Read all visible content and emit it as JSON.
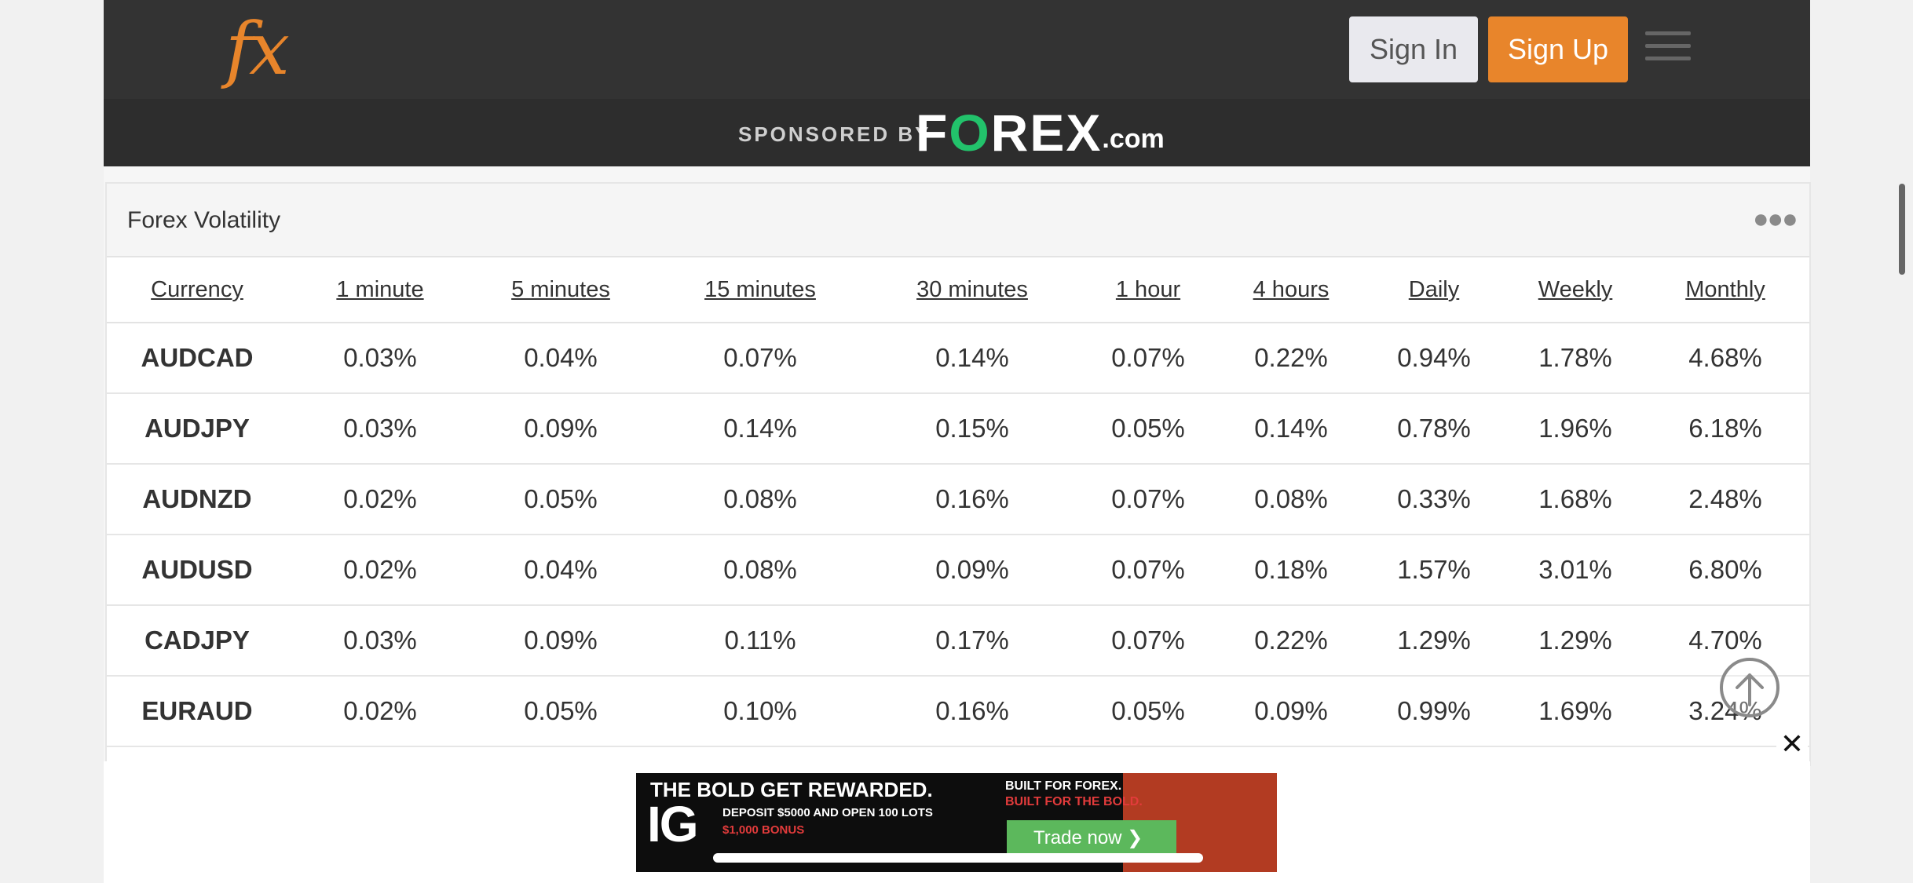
{
  "header": {
    "logo_text": "fx",
    "sign_in": "Sign In",
    "sign_up": "Sign Up",
    "menu_icon": "hamburger-icon"
  },
  "sponsor": {
    "label": "SPONSORED BY",
    "brand_f": "F",
    "brand_o": "O",
    "brand_rest": "REX",
    "brand_suffix": ".com"
  },
  "widget": {
    "title": "Forex Volatility",
    "more_icon": "more-dots-icon",
    "columns": [
      "Currency",
      "1 minute",
      "5 minutes",
      "15 minutes",
      "30 minutes",
      "1 hour",
      "4 hours",
      "Daily",
      "Weekly",
      "Monthly"
    ],
    "rows": [
      [
        "AUDCAD",
        "0.03%",
        "0.04%",
        "0.07%",
        "0.14%",
        "0.07%",
        "0.22%",
        "0.94%",
        "1.78%",
        "4.68%"
      ],
      [
        "AUDJPY",
        "0.03%",
        "0.09%",
        "0.14%",
        "0.15%",
        "0.05%",
        "0.14%",
        "0.78%",
        "1.96%",
        "6.18%"
      ],
      [
        "AUDNZD",
        "0.02%",
        "0.05%",
        "0.08%",
        "0.16%",
        "0.07%",
        "0.08%",
        "0.33%",
        "1.68%",
        "2.48%"
      ],
      [
        "AUDUSD",
        "0.02%",
        "0.04%",
        "0.08%",
        "0.09%",
        "0.07%",
        "0.18%",
        "1.57%",
        "3.01%",
        "6.80%"
      ],
      [
        "CADJPY",
        "0.03%",
        "0.09%",
        "0.11%",
        "0.17%",
        "0.07%",
        "0.22%",
        "1.29%",
        "1.29%",
        "4.70%"
      ],
      [
        "EURAUD",
        "0.02%",
        "0.05%",
        "0.10%",
        "0.16%",
        "0.05%",
        "0.09%",
        "0.99%",
        "1.69%",
        "3.24%"
      ]
    ]
  },
  "to_top_icon": "arrow-up-circle-icon",
  "ad": {
    "close_label": "✕",
    "headline": "THE BOLD GET REWARDED.",
    "logo": "IG",
    "deposit": "DEPOSIT $5000 AND OPEN 100 LOTS",
    "bonus": "$1,000 BONUS",
    "built1": "BUILT FOR FOREX.",
    "built2": "BUILT FOR THE BOLD.",
    "cta": "Trade now ❯"
  },
  "colors": {
    "accent": "#e8852b",
    "header_bg": "#333333",
    "sponsor_bg": "#2d2d2d",
    "brand_green": "#22c26b"
  }
}
